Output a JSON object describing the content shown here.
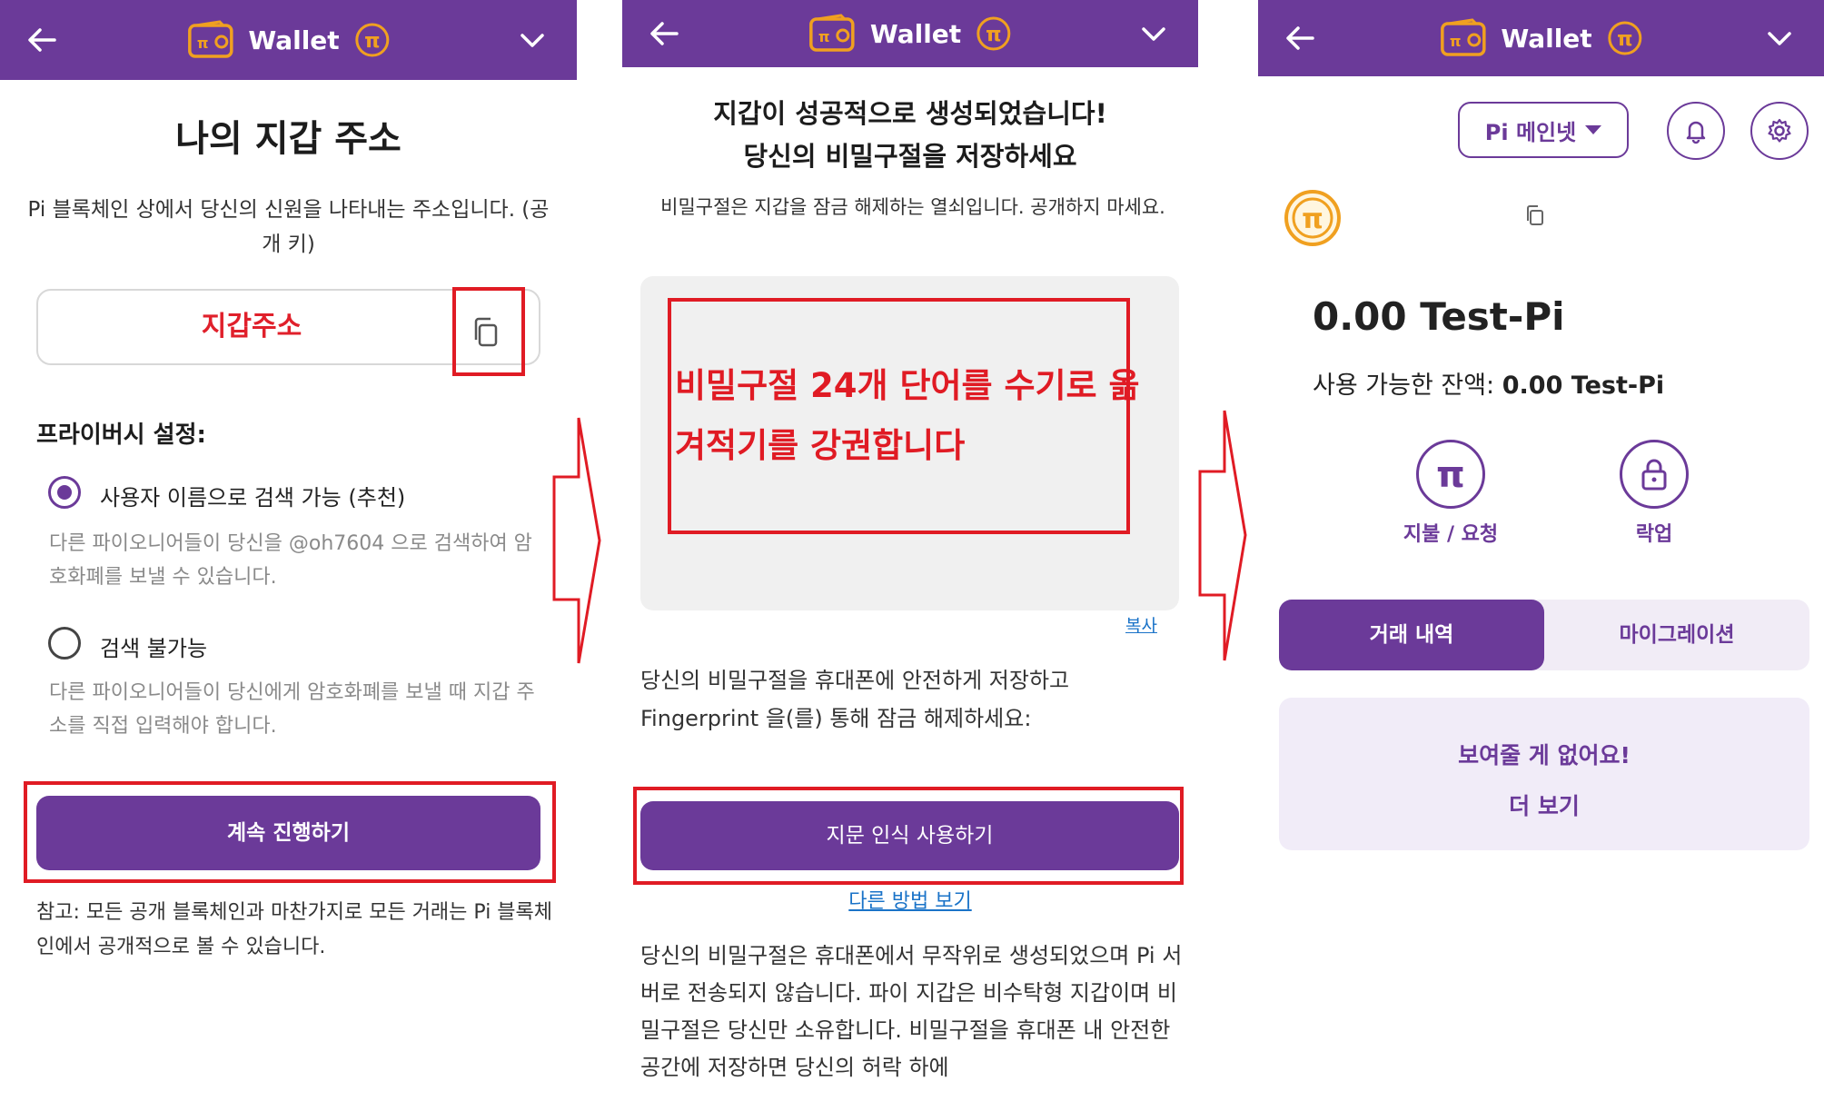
{
  "colors": {
    "brand_purple": "#6b3a99",
    "highlight_red": "#e01b24",
    "link_blue": "#1a73c8",
    "accent_gold": "#f0a020"
  },
  "header": {
    "title": "Wallet"
  },
  "screen1": {
    "title": "나의 지갑 주소",
    "description": "Pi 블록체인 상에서 당신의 신원을 나타내는 주소입니다. (공개 키)",
    "address_label": "지갑주소",
    "privacy_title": "프라이버시 설정:",
    "option_searchable": {
      "label": "사용자 이름으로 검색 가능 (추천)",
      "description": "다른 파이오니어들이 당신을 @oh7604 으로 검색하여 암호화폐를 보낼 수 있습니다.",
      "selected": true
    },
    "option_unsearchable": {
      "label": "검색 불가능",
      "description": "다른 파이오니어들이 당신에게 암호화폐를 보낼 때 지갑 주소를 직접 입력해야 합니다.",
      "selected": false
    },
    "continue_button": "계속 진행하기",
    "note": "참고: 모든 공개 블록체인과 마찬가지로 모든 거래는 Pi 블록체인에서 공개적으로 볼 수 있습니다."
  },
  "screen2": {
    "title_line1": "지갑이 성공적으로 생성되었습니다!",
    "title_line2": "당신의 비밀구절을 저장하세요",
    "description": "비밀구절은 지갑을 잠금 해제하는 열쇠입니다. 공개하지 마세요.",
    "phrase_annotation": "비밀구절 24개 단어를 수기로 옮겨적기를 강권합니다",
    "copy_link": "복사",
    "store_text": "당신의 비밀구절을 휴대폰에 안전하게 저장하고 Fingerprint 을(를) 통해 잠금 해제하세요:",
    "fingerprint_button": "지문 인식 사용하기",
    "other_method_link": "다른 방법 보기",
    "explanation": "당신의 비밀구절은 휴대폰에서 무작위로 생성되었으며 Pi 서버로 전송되지 않습니다. 파이 지갑은 비수탁형 지갑이며 비밀구절은 당신만 소유합니다. 비밀구절을 휴대폰 내 안전한 공간에 저장하면 당신의 허락 하에"
  },
  "screen3": {
    "network": "Pi 메인넷",
    "balance": "0.00 Test-Pi",
    "available_label": "사용 가능한 잔액:",
    "available_value": "0.00 Test-Pi",
    "actions": [
      {
        "label": "지불 / 요청",
        "icon": "pi-symbol-icon"
      },
      {
        "label": "락업",
        "icon": "lock-icon"
      }
    ],
    "tabs": [
      "거래 내역",
      "마이그레이션"
    ],
    "active_tab": "거래 내역",
    "empty_title": "보여줄 게 없어요!",
    "empty_more": "더 보기"
  }
}
